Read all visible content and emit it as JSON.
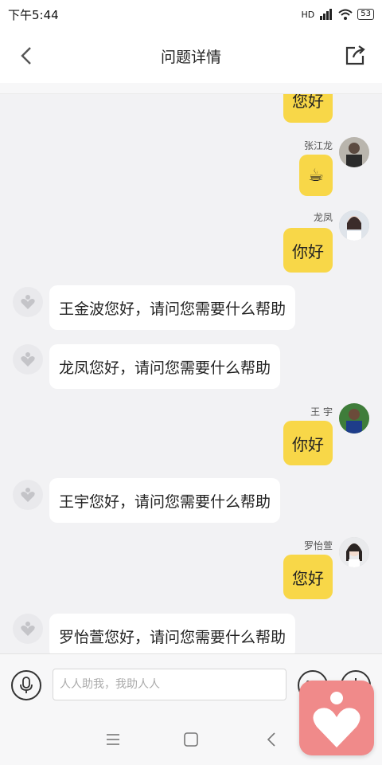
{
  "status_bar": {
    "time": "下午5:44",
    "network": "HD",
    "battery": "53"
  },
  "header": {
    "title": "问题详情"
  },
  "messages": {
    "m0": {
      "text": "您好"
    },
    "m1": {
      "name": "张江龙",
      "text": "☕"
    },
    "m2": {
      "name": "龙凤",
      "text": "你好"
    },
    "m3": {
      "text": "王金波您好，请问您需要什么帮助"
    },
    "m4": {
      "text": "龙凤您好，请问您需要什么帮助"
    },
    "m5": {
      "name": "王 宇",
      "text": "你好"
    },
    "m6": {
      "text": "王宇您好，请问您需要什么帮助"
    },
    "m7": {
      "name": "罗怡萱",
      "text": "您好"
    },
    "m8": {
      "text": "罗怡萱您好，请问您需要什么帮助"
    }
  },
  "input": {
    "placeholder": "人人助我，我助人人"
  },
  "colors": {
    "outgoing_bubble": "#f8d748",
    "incoming_bubble": "#ffffff",
    "badge": "#f08a8a"
  }
}
